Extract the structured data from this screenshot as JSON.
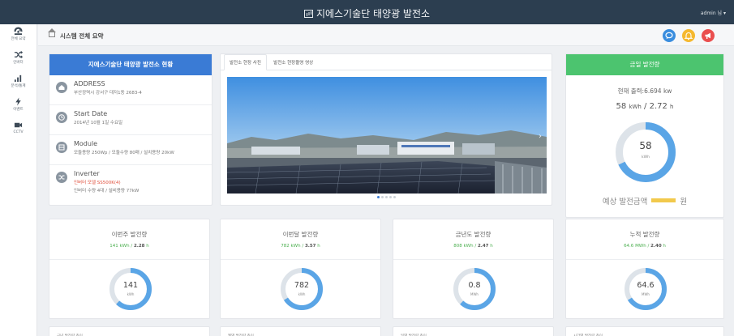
{
  "header": {
    "title": "지에스기술단 태양광 발전소",
    "user": "admin 님"
  },
  "sidebar": {
    "items": [
      {
        "icon": "dashboard-icon",
        "label": "전체 요약"
      },
      {
        "icon": "shuffle-icon",
        "label": "인버터"
      },
      {
        "icon": "bar-chart-icon",
        "label": "분석/통계"
      },
      {
        "icon": "lightning-icon",
        "label": "이벤트"
      },
      {
        "icon": "video-camera-icon",
        "label": "CCTV"
      }
    ]
  },
  "page": {
    "title": "시스템 전체 요약"
  },
  "actions": [
    {
      "icon": "chat-icon",
      "color": "#3a8dde"
    },
    {
      "icon": "bell-icon",
      "color": "#f5b82e"
    },
    {
      "icon": "megaphone-icon",
      "color": "#ea4f4f"
    }
  ],
  "plant_info": {
    "title": "지에스기술단 태양광 발전소 현황",
    "rows": [
      {
        "name": "ADDRESS",
        "value": "부산광역시 강서구 대저1동 2683-4",
        "value2": ""
      },
      {
        "name": "Start Date",
        "value": "2014년 10월 1일 수요일",
        "value2": ""
      },
      {
        "name": "Module",
        "value": "모듈용량 250Wp / 모듈수량 80매 / 설치용량 20kW",
        "value2": ""
      },
      {
        "name": "Inverter",
        "value": "인버터 모델 SS500K(4)",
        "value2": "인버터 수량 4대 / 설비용량 77kW"
      }
    ]
  },
  "media": {
    "tabs": [
      "발전소 현장 사진",
      "발전소 현장촬영 영상"
    ],
    "slides": 5,
    "active_slide": 0
  },
  "today": {
    "title": "금일 발전량",
    "current_output": "현재 출력:6.694 kw",
    "kwh": "58",
    "kwh_unit": "kWh",
    "hours": "2.72",
    "hours_unit": "h",
    "ring_value": "58",
    "ring_unit": "kWh",
    "ring_fraction": 0.68,
    "expected_label": "예상 발전금액",
    "expected_unit": "원",
    "expected_color": "#f2c94c"
  },
  "stats": [
    {
      "title": "이번주 발전량",
      "kwh": "141",
      "kwh_unit": "kWh",
      "hours": "2.28",
      "hours_unit": "h",
      "ring_value": "141",
      "ring_unit": "kWh",
      "ring_fraction": 0.62
    },
    {
      "title": "이번달 발전량",
      "kwh": "782",
      "kwh_unit": "kWh",
      "hours": "3.57",
      "hours_unit": "h",
      "ring_value": "782",
      "ring_unit": "kWh",
      "ring_fraction": 0.66
    },
    {
      "title": "금년도 발전량",
      "kwh": "808",
      "kwh_unit": "kWh",
      "hours": "2.47",
      "hours_unit": "h",
      "ring_value": "0.8",
      "ring_unit": "MWh",
      "ring_fraction": 0.62
    },
    {
      "title": "누적 발전량",
      "kwh": "64.6",
      "kwh_unit": "MWh",
      "hours": "2.40",
      "hours_unit": "h",
      "ring_value": "64.6",
      "ring_unit": "MWh",
      "ring_fraction": 0.66
    }
  ],
  "bottom_cards": [
    "금년 발전량 추이",
    "월별 발전량 추이",
    "일별 발전량 추이",
    "시간별 발전량 추이"
  ],
  "colors": {
    "accent": "#3a7bd5",
    "ring": "#5aa5e6",
    "ring_track": "#dde3e9",
    "green": "#4cc46f"
  }
}
